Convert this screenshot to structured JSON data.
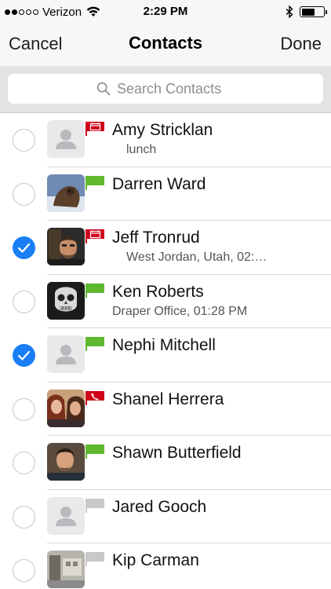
{
  "status_bar": {
    "carrier": "Verizon",
    "time": "2:29 PM",
    "signal_bars_filled": 2,
    "signal_bars_total": 5,
    "battery_level": 0.6
  },
  "nav": {
    "left_label": "Cancel",
    "title": "Contacts",
    "right_label": "Done"
  },
  "search": {
    "placeholder": "Search Contacts",
    "value": ""
  },
  "colors": {
    "accent": "#1a7ff5",
    "flag_busy": "#d0021b",
    "flag_available": "#5fb82e",
    "flag_offline": "#c8c8c8"
  },
  "contacts": [
    {
      "name": "Amy Stricklan",
      "detail": "lunch",
      "detail_indent": true,
      "selected": false,
      "flag_status": "busy",
      "flag_icon": "calendar",
      "avatar": "placeholder"
    },
    {
      "name": "Darren Ward",
      "detail": "",
      "detail_indent": false,
      "selected": false,
      "flag_status": "available",
      "flag_icon": "none",
      "avatar": "photo-darren"
    },
    {
      "name": "Jeff Tronrud",
      "detail": "West Jordan, Utah, 02:…",
      "detail_indent": true,
      "selected": true,
      "flag_status": "busy",
      "flag_icon": "calendar",
      "avatar": "photo-jeff"
    },
    {
      "name": "Ken Roberts",
      "detail": "Draper Office, 01:28 PM",
      "detail_indent": false,
      "selected": false,
      "flag_status": "available",
      "flag_icon": "none",
      "avatar": "photo-ken"
    },
    {
      "name": "Nephi Mitchell",
      "detail": "",
      "detail_indent": false,
      "selected": true,
      "flag_status": "available",
      "flag_icon": "none",
      "avatar": "placeholder"
    },
    {
      "name": "Shanel Herrera",
      "detail": "",
      "detail_indent": false,
      "selected": false,
      "flag_status": "busy",
      "flag_icon": "phone",
      "avatar": "photo-shanel"
    },
    {
      "name": "Shawn Butterfield",
      "detail": "",
      "detail_indent": false,
      "selected": false,
      "flag_status": "available",
      "flag_icon": "none",
      "avatar": "photo-shawn"
    },
    {
      "name": "Jared Gooch",
      "detail": "",
      "detail_indent": false,
      "selected": false,
      "flag_status": "offline",
      "flag_icon": "none",
      "avatar": "placeholder"
    },
    {
      "name": "Kip Carman",
      "detail": "",
      "detail_indent": false,
      "selected": false,
      "flag_status": "offline",
      "flag_icon": "none",
      "avatar": "photo-kip"
    }
  ]
}
